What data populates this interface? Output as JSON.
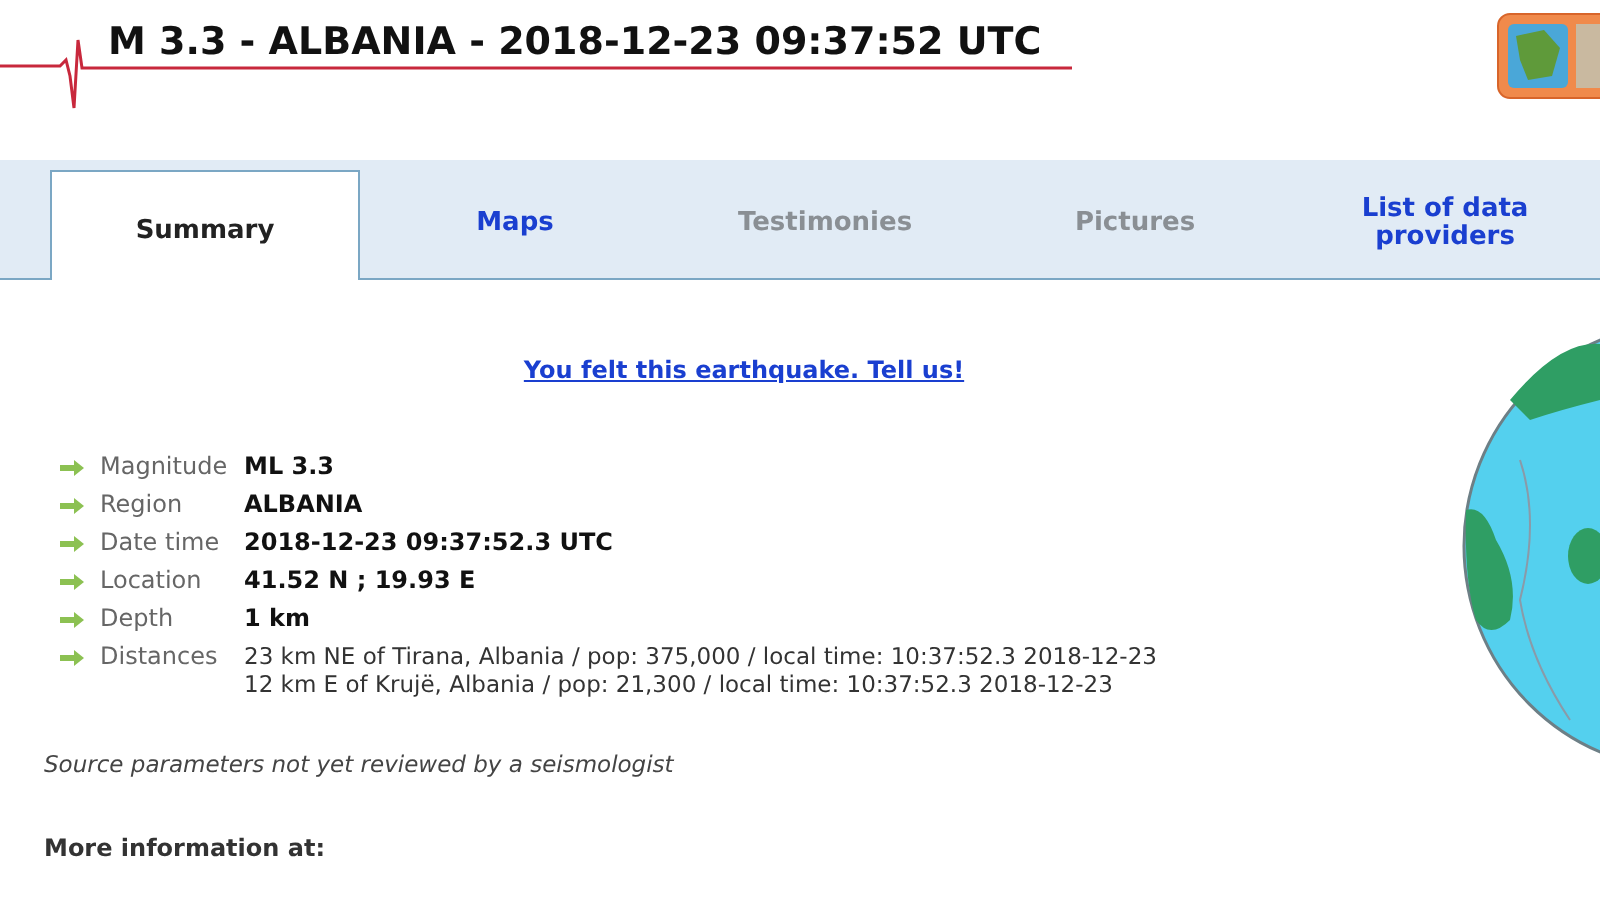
{
  "header": {
    "title": "M 3.3 - ALBANIA - 2018-12-23 09:37:52 UTC"
  },
  "tabs": [
    {
      "label": "Summary",
      "selected": true,
      "disabled": false
    },
    {
      "label": "Maps",
      "selected": false,
      "disabled": false
    },
    {
      "label": "Testimonies",
      "selected": false,
      "disabled": true
    },
    {
      "label": "Pictures",
      "selected": false,
      "disabled": true
    },
    {
      "label": "List of data providers",
      "selected": false,
      "disabled": false
    }
  ],
  "felt_link": "You felt this earthquake. Tell us!",
  "details": [
    {
      "label": "Magnitude",
      "values": [
        "ML 3.3"
      ],
      "bold": true
    },
    {
      "label": "Region",
      "values": [
        "ALBANIA"
      ],
      "bold": true
    },
    {
      "label": "Date time",
      "values": [
        "2018-12-23 09:37:52.3 UTC"
      ],
      "bold": true
    },
    {
      "label": "Location",
      "values": [
        "41.52 N ; 19.93 E"
      ],
      "bold": true
    },
    {
      "label": "Depth",
      "values": [
        "1 km"
      ],
      "bold": true
    },
    {
      "label": "Distances",
      "values": [
        "23 km NE of Tirana, Albania / pop: 375,000 / local time: 10:37:52.3 2018-12-23",
        "12 km E of Krujë, Albania / pop: 21,300 / local time: 10:37:52.3 2018-12-23"
      ],
      "bold": false
    }
  ],
  "review_note": "Source parameters not yet reviewed by a seismologist",
  "more_info_heading": "More information at:"
}
